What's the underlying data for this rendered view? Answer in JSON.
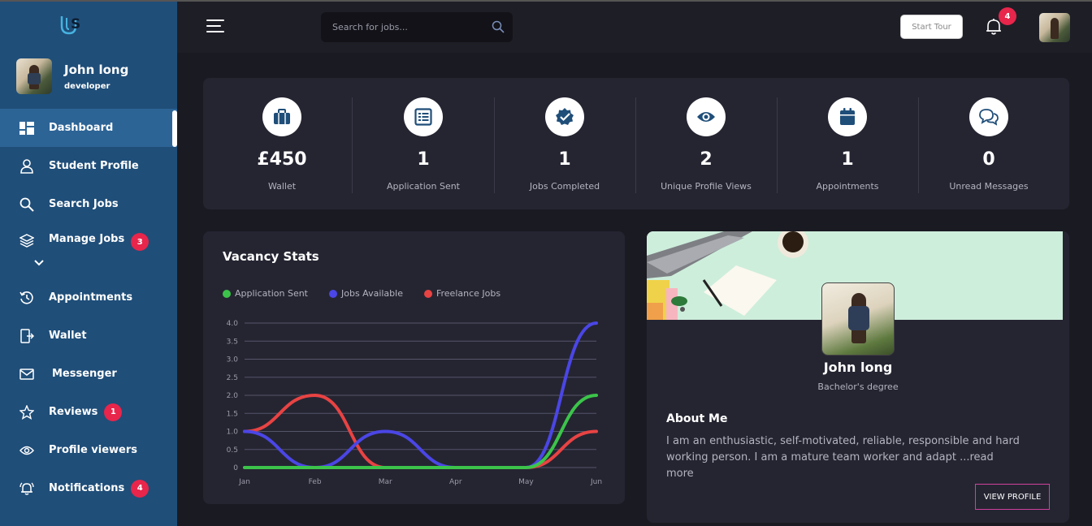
{
  "sidebar": {
    "user": {
      "name": "John long",
      "role": "developer"
    },
    "items": [
      {
        "label": "Dashboard",
        "icon": "dashboard-icon",
        "active": true
      },
      {
        "label": "Student Profile",
        "icon": "user-icon"
      },
      {
        "label": "Search Jobs",
        "icon": "search-icon"
      },
      {
        "label": "Manage Jobs",
        "icon": "layers-icon",
        "badge": "3"
      },
      {
        "label": "Appointments",
        "icon": "history-icon"
      },
      {
        "label": "Wallet",
        "icon": "wallet-icon"
      },
      {
        "label": "Messenger",
        "icon": "envelope-icon"
      },
      {
        "label": "Reviews",
        "icon": "star-icon",
        "badge": "1"
      },
      {
        "label": "Profile viewers",
        "icon": "eye-icon"
      },
      {
        "label": "Notifications",
        "icon": "bell-ring-icon",
        "badge": "4"
      }
    ]
  },
  "topbar": {
    "search_placeholder": "Search for jobs...",
    "tour_label": "Start Tour",
    "notification_count": "4"
  },
  "stats": [
    {
      "value": "£450",
      "label": "Wallet",
      "icon": "briefcase-icon"
    },
    {
      "value": "1",
      "label": "Application Sent",
      "icon": "list-icon"
    },
    {
      "value": "1",
      "label": "Jobs Completed",
      "icon": "badge-check-icon"
    },
    {
      "value": "2",
      "label": "Unique Profile Views",
      "icon": "eye-icon"
    },
    {
      "value": "1",
      "label": "Appointments",
      "icon": "calendar-icon"
    },
    {
      "value": "0",
      "label": "Unread Messages",
      "icon": "chat-icon"
    }
  ],
  "chart_data": {
    "type": "line",
    "title": "Vacancy Stats",
    "categories": [
      "Jan",
      "Feb",
      "Mar",
      "Apr",
      "May",
      "Jun"
    ],
    "ylim": [
      0,
      4
    ],
    "yticks": [
      "0",
      "0.5",
      "1.0",
      "1.5",
      "2.0",
      "2.5",
      "3.0",
      "3.5",
      "4.0"
    ],
    "legend_position": "top",
    "grid": true,
    "series": [
      {
        "name": "Application Sent",
        "color": "#3cc44a",
        "values": [
          0,
          0,
          0,
          0,
          0,
          2
        ]
      },
      {
        "name": "Jobs Available",
        "color": "#4b46e6",
        "values": [
          1,
          0,
          1,
          0,
          0,
          4
        ]
      },
      {
        "name": "Freelance Jobs",
        "color": "#e84343",
        "values": [
          1,
          2,
          0,
          0,
          0,
          1
        ]
      }
    ]
  },
  "profile": {
    "name": "John long",
    "degree": "Bachelor's degree",
    "about_title": "About Me",
    "about_text": "I am an enthusiastic, self-motivated, reliable, responsible and hard working person. I am a mature team worker and adapt ...read more",
    "button_label": "VIEW PROFILE"
  }
}
